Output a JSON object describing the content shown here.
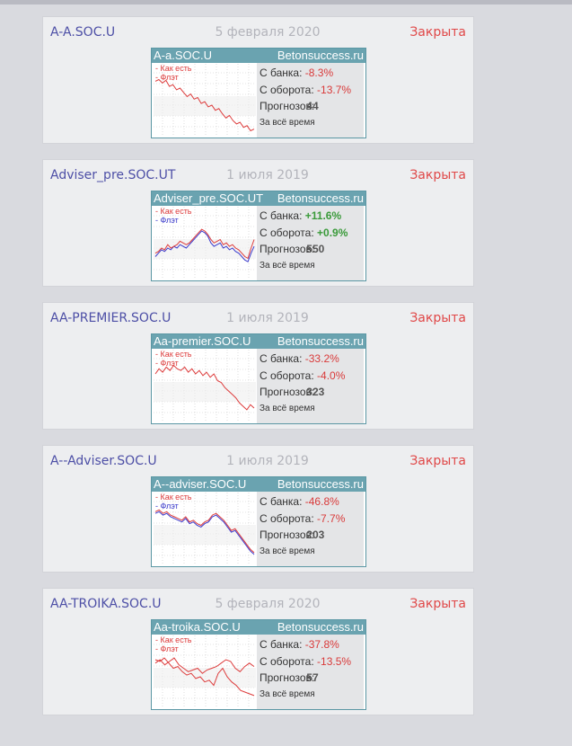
{
  "colors": {
    "accent_link": "#4d4fa6",
    "closed": "#e04848",
    "as_is": "#dd3b3b",
    "flat": "#3b3bcc",
    "positive": "#3a9a3a",
    "negative": "#d93a3a"
  },
  "labels": {
    "bank": "С банка:",
    "turnover": "С оборота:",
    "forecasts": "Прогнозов:",
    "all_time": "За всё время",
    "legend_as_is": "- Как есть",
    "legend_flat": "- Флэт",
    "site": "Betonsuccess.ru"
  },
  "cards": [
    {
      "name": "A-A.SOC.U",
      "date": "5 февраля 2020",
      "status": "Закрыта",
      "widget_title": "A-a.SOC.U",
      "bank": "-8.3%",
      "bank_sign": "neg",
      "turnover": "-13.7%",
      "turnover_sign": "neg",
      "forecasts": "44",
      "as_is": [
        12,
        10,
        14,
        11,
        18,
        16,
        22,
        20,
        25,
        30,
        27,
        33,
        31,
        38,
        36,
        42,
        40,
        46,
        44,
        50,
        55,
        52,
        58,
        62,
        60,
        66,
        64,
        70,
        68
      ]
    },
    {
      "name": "Adviser_pre.SOC.UT",
      "date": "1 июля 2019",
      "status": "Закрыта",
      "widget_title": "Adviser_pre.SOC.UT",
      "bank": "+11.6%",
      "bank_sign": "pos",
      "turnover": "+0.9%",
      "turnover_sign": "pos",
      "forecasts": "550",
      "as_is": [
        46,
        44,
        40,
        42,
        36,
        40,
        38,
        36,
        32,
        34,
        36,
        34,
        30,
        26,
        22,
        18,
        20,
        24,
        30,
        34,
        32,
        30,
        36,
        34,
        38,
        36,
        40,
        42,
        46,
        50,
        52,
        40,
        30
      ],
      "flat": [
        50,
        46,
        42,
        44,
        40,
        42,
        38,
        40,
        36,
        38,
        40,
        36,
        32,
        28,
        24,
        20,
        22,
        26,
        34,
        38,
        36,
        34,
        40,
        38,
        42,
        40,
        44,
        46,
        50,
        54,
        56,
        46,
        38
      ]
    },
    {
      "name": "AA-PREMIER.SOC.U",
      "date": "1 июля 2019",
      "status": "Закрыта",
      "widget_title": "Aa-premier.SOC.U",
      "bank": "-33.2%",
      "bank_sign": "neg",
      "turnover": "-4.0%",
      "turnover_sign": "neg",
      "forecasts": "323",
      "as_is": [
        20,
        14,
        18,
        12,
        16,
        10,
        14,
        16,
        12,
        18,
        14,
        20,
        16,
        22,
        18,
        24,
        20,
        28,
        30,
        36,
        40,
        44,
        48,
        54,
        58,
        62,
        56,
        60
      ]
    },
    {
      "name": "A--Adviser.SOC.U",
      "date": "1 июля 2019",
      "status": "Закрыта",
      "widget_title": "A--adviser.SOC.U",
      "bank": "-46.8%",
      "bank_sign": "neg",
      "turnover": "-7.7%",
      "turnover_sign": "neg",
      "forecasts": "203",
      "as_is": [
        14,
        12,
        16,
        14,
        18,
        20,
        22,
        24,
        20,
        26,
        24,
        28,
        30,
        26,
        24,
        18,
        16,
        20,
        24,
        30,
        36,
        34,
        40,
        46,
        52,
        58,
        62
      ],
      "flat": [
        16,
        14,
        18,
        16,
        20,
        22,
        24,
        26,
        22,
        28,
        26,
        30,
        32,
        28,
        26,
        20,
        18,
        22,
        26,
        32,
        38,
        36,
        42,
        48,
        54,
        60,
        64
      ]
    },
    {
      "name": "AA-TROIKA.SOC.U",
      "date": "5 февраля 2020",
      "status": "Закрыта",
      "widget_title": "Aa-troika.SOC.U",
      "bank": "-37.8%",
      "bank_sign": "neg",
      "turnover": "-13.5%",
      "turnover_sign": "neg",
      "forecasts": "57",
      "as_is": [
        20,
        22,
        18,
        24,
        30,
        28,
        34,
        38,
        36,
        42,
        40,
        46,
        44,
        50,
        36,
        30,
        40,
        46,
        50,
        56,
        58,
        60,
        62
      ],
      "as_is_b": [
        24,
        20,
        26,
        22,
        18,
        26,
        30,
        34,
        32,
        30,
        36,
        32,
        30,
        28,
        24,
        20,
        22,
        30,
        34,
        28,
        24,
        28
      ]
    }
  ]
}
